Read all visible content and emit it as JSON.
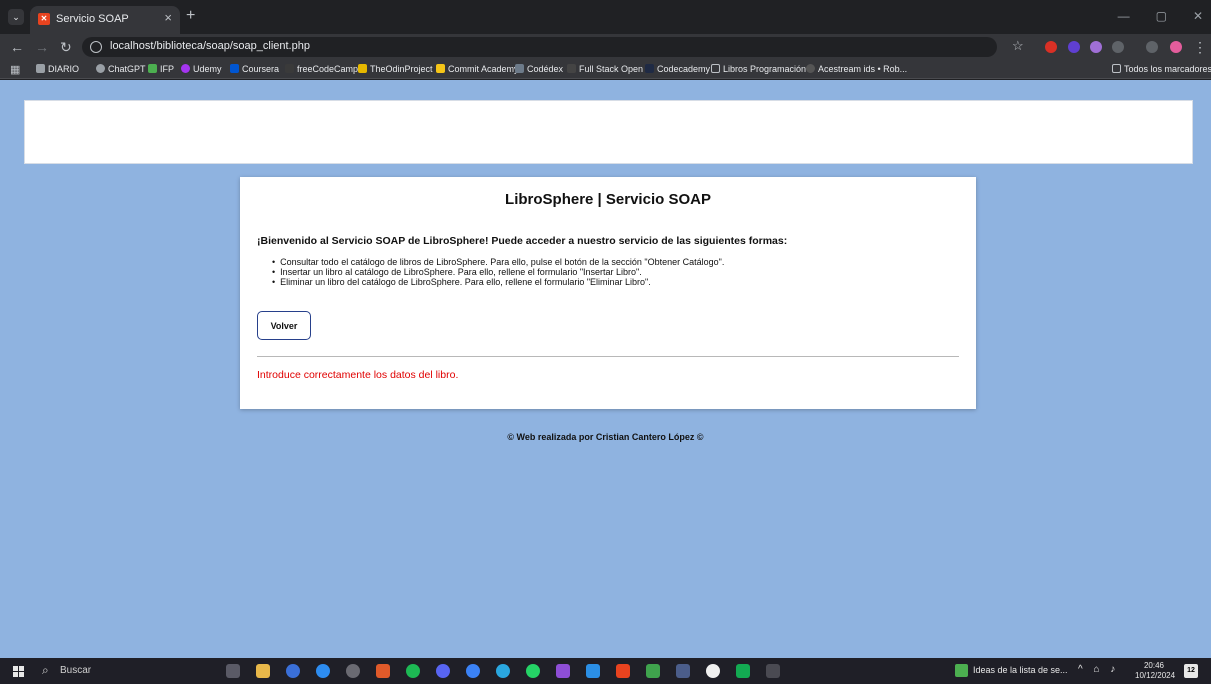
{
  "browser": {
    "tab_title": "Servicio SOAP",
    "tab_close": "×",
    "new_tab": "+",
    "url": "localhost/biblioteca/soap/soap_client.php",
    "minimize": "—",
    "maximize": "▢",
    "close": "✕",
    "bookmarks": [
      {
        "label": "DIARIO",
        "color": "#9aa0a6"
      },
      {
        "label": "ChatGPT",
        "color": "#9aa0a6"
      },
      {
        "label": "IFP",
        "color": "#4caf50"
      },
      {
        "label": "Udemy",
        "color": "#a435f0"
      },
      {
        "label": "Coursera",
        "color": "#0056d2"
      },
      {
        "label": "freeCodeCamp",
        "color": "#3a3a3a"
      },
      {
        "label": "TheOdinProject",
        "color": "#e6b800"
      },
      {
        "label": "Commit Academy",
        "color": "#f5c518"
      },
      {
        "label": "Codédex",
        "color": "#6d7b8a"
      },
      {
        "label": "Full Stack Open",
        "color": "#444"
      },
      {
        "label": "Codecademy",
        "color": "#1f2a44"
      },
      {
        "label": "Libros Programación",
        "color": "#5f6368"
      },
      {
        "label": "Acestream ids • Rob...",
        "color": "#555"
      }
    ],
    "all_bookmarks": "Todos los marcadores"
  },
  "page": {
    "title": "LibroSphere | Servicio SOAP",
    "welcome": "¡Bienvenido al Servicio SOAP de LibroSphere! Puede acceder a nuestro servicio de las siguientes formas:",
    "bullets": [
      "Consultar todo el catálogo de libros de LibroSphere. Para ello, pulse el botón de la sección \"Obtener Catálogo\".",
      "Insertar un libro al catálogo de LibroSphere. Para ello, rellene el formulario \"Insertar Libro\".",
      "Eliminar un libro del catálogo de LibroSphere. Para ello, rellene el formulario \"Eliminar Libro\"."
    ],
    "back_button": "Volver",
    "error_message": "Introduce correctamente los datos del libro.",
    "footer": "© Web realizada por Cristian Cantero López ©"
  },
  "taskbar": {
    "search_placeholder": "Buscar",
    "widget_text": "Ideas de la lista de se...",
    "time": "20:46",
    "date": "10/12/2024",
    "notification_count": "12"
  },
  "colors": {
    "page_background": "#8fb3e0",
    "error_text": "#e00000",
    "button_border": "#27408b"
  }
}
